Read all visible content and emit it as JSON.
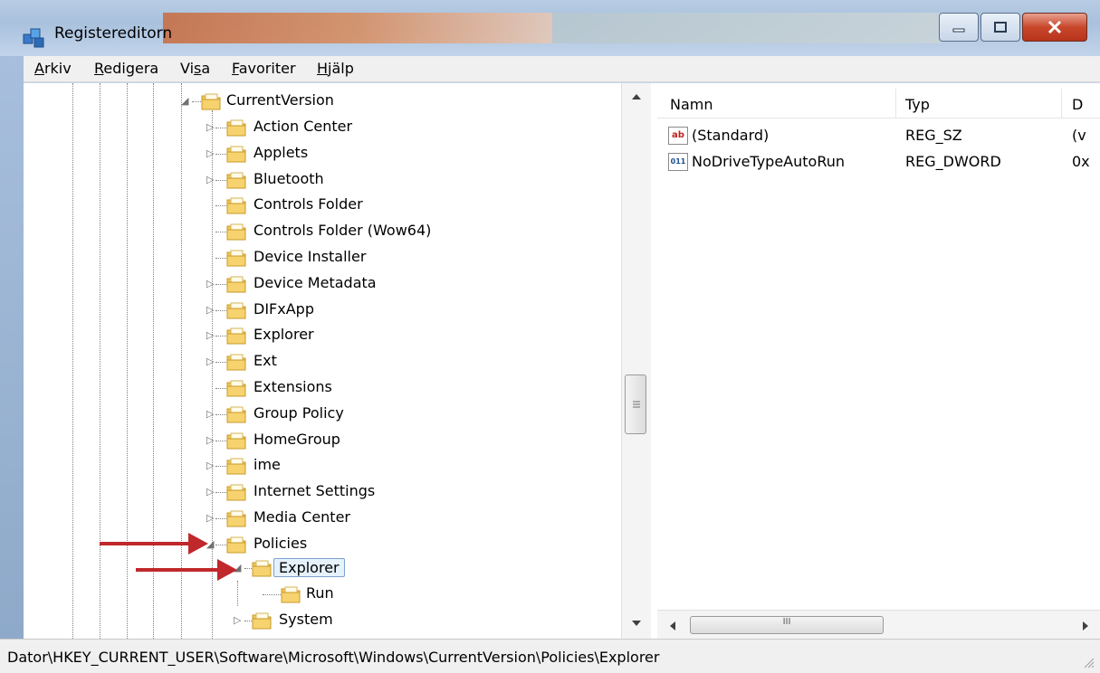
{
  "window": {
    "title": "Registereditorn"
  },
  "menu": [
    {
      "pre": "",
      "u": "A",
      "post": "rkiv"
    },
    {
      "pre": "",
      "u": "R",
      "post": "edigera"
    },
    {
      "pre": "Vi",
      "u": "s",
      "post": "a"
    },
    {
      "pre": "",
      "u": "F",
      "post": "avoriter"
    },
    {
      "pre": "",
      "u": "H",
      "post": "jälp"
    }
  ],
  "tree": {
    "root": "CurrentVersion",
    "items": [
      "Action Center",
      "Applets",
      "Bluetooth",
      "Controls Folder",
      "Controls Folder (Wow64)",
      "Device Installer",
      "Device Metadata",
      "DIFxApp",
      "Explorer",
      "Ext",
      "Extensions",
      "Group Policy",
      "HomeGroup",
      "ime",
      "Internet Settings",
      "Media Center",
      "Policies"
    ],
    "policies_children": [
      "Explorer"
    ],
    "explorer_children": [
      "Run"
    ],
    "after": [
      "System"
    ]
  },
  "values": {
    "columns": [
      "Namn",
      "Typ",
      "D"
    ],
    "rows": [
      {
        "name": "(Standard)",
        "type": "REG_SZ",
        "data": "(v",
        "icon": "ab"
      },
      {
        "name": "NoDriveTypeAutoRun",
        "type": "REG_DWORD",
        "data": "0x",
        "icon": "011"
      }
    ]
  },
  "status": {
    "path": "Dator\\HKEY_CURRENT_USER\\Software\\Microsoft\\Windows\\CurrentVersion\\Policies\\Explorer"
  },
  "scroll_thumb_mark": "III",
  "colors": {
    "arrow": "#c0282b",
    "folder": "#f1c75a",
    "selection": "#e5f1fb"
  }
}
